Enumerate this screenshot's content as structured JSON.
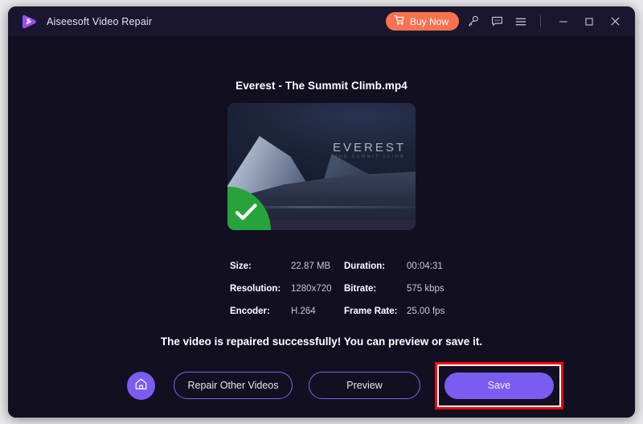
{
  "window": {
    "app_title": "Aiseesoft Video Repair",
    "logo_icon": "play-logo-icon",
    "accent_color": "#7b5cf0",
    "buy_color": "#f9724f",
    "background_color": "#120f21"
  },
  "titlebar": {
    "buy_now_label": "Buy Now",
    "cart_icon": "shopping-cart-icon",
    "register_icon": "key-icon",
    "feedback_icon": "speech-bubble-icon",
    "menu_icon": "hamburger-menu-icon",
    "minimize_icon": "minimize-icon",
    "maximize_icon": "maximize-icon",
    "close_icon": "close-icon"
  },
  "main": {
    "file_name": "Everest - The Summit Climb.mp4",
    "thumbnail": {
      "overlay_title": "EVEREST",
      "overlay_subtitle": "THE SUMMIT CLIMB",
      "badge_icon": "check-mark-icon",
      "badge_color": "#27a33c"
    },
    "metadata": [
      {
        "label": "Size:",
        "value": "22.87 MB",
        "label2": "Duration:",
        "value2": "00:04:31"
      },
      {
        "label": "Resolution:",
        "value": "1280x720",
        "label2": "Bitrate:",
        "value2": "575 kbps"
      },
      {
        "label": "Encoder:",
        "value": "H.264",
        "label2": "Frame Rate:",
        "value2": "25.00 fps"
      }
    ],
    "status_message": "The video is repaired successfully! You can preview or save it."
  },
  "actions": {
    "home_icon": "home-icon",
    "repair_other_label": "Repair Other Videos",
    "preview_label": "Preview",
    "save_label": "Save",
    "highlight_color": "#ff0000"
  }
}
